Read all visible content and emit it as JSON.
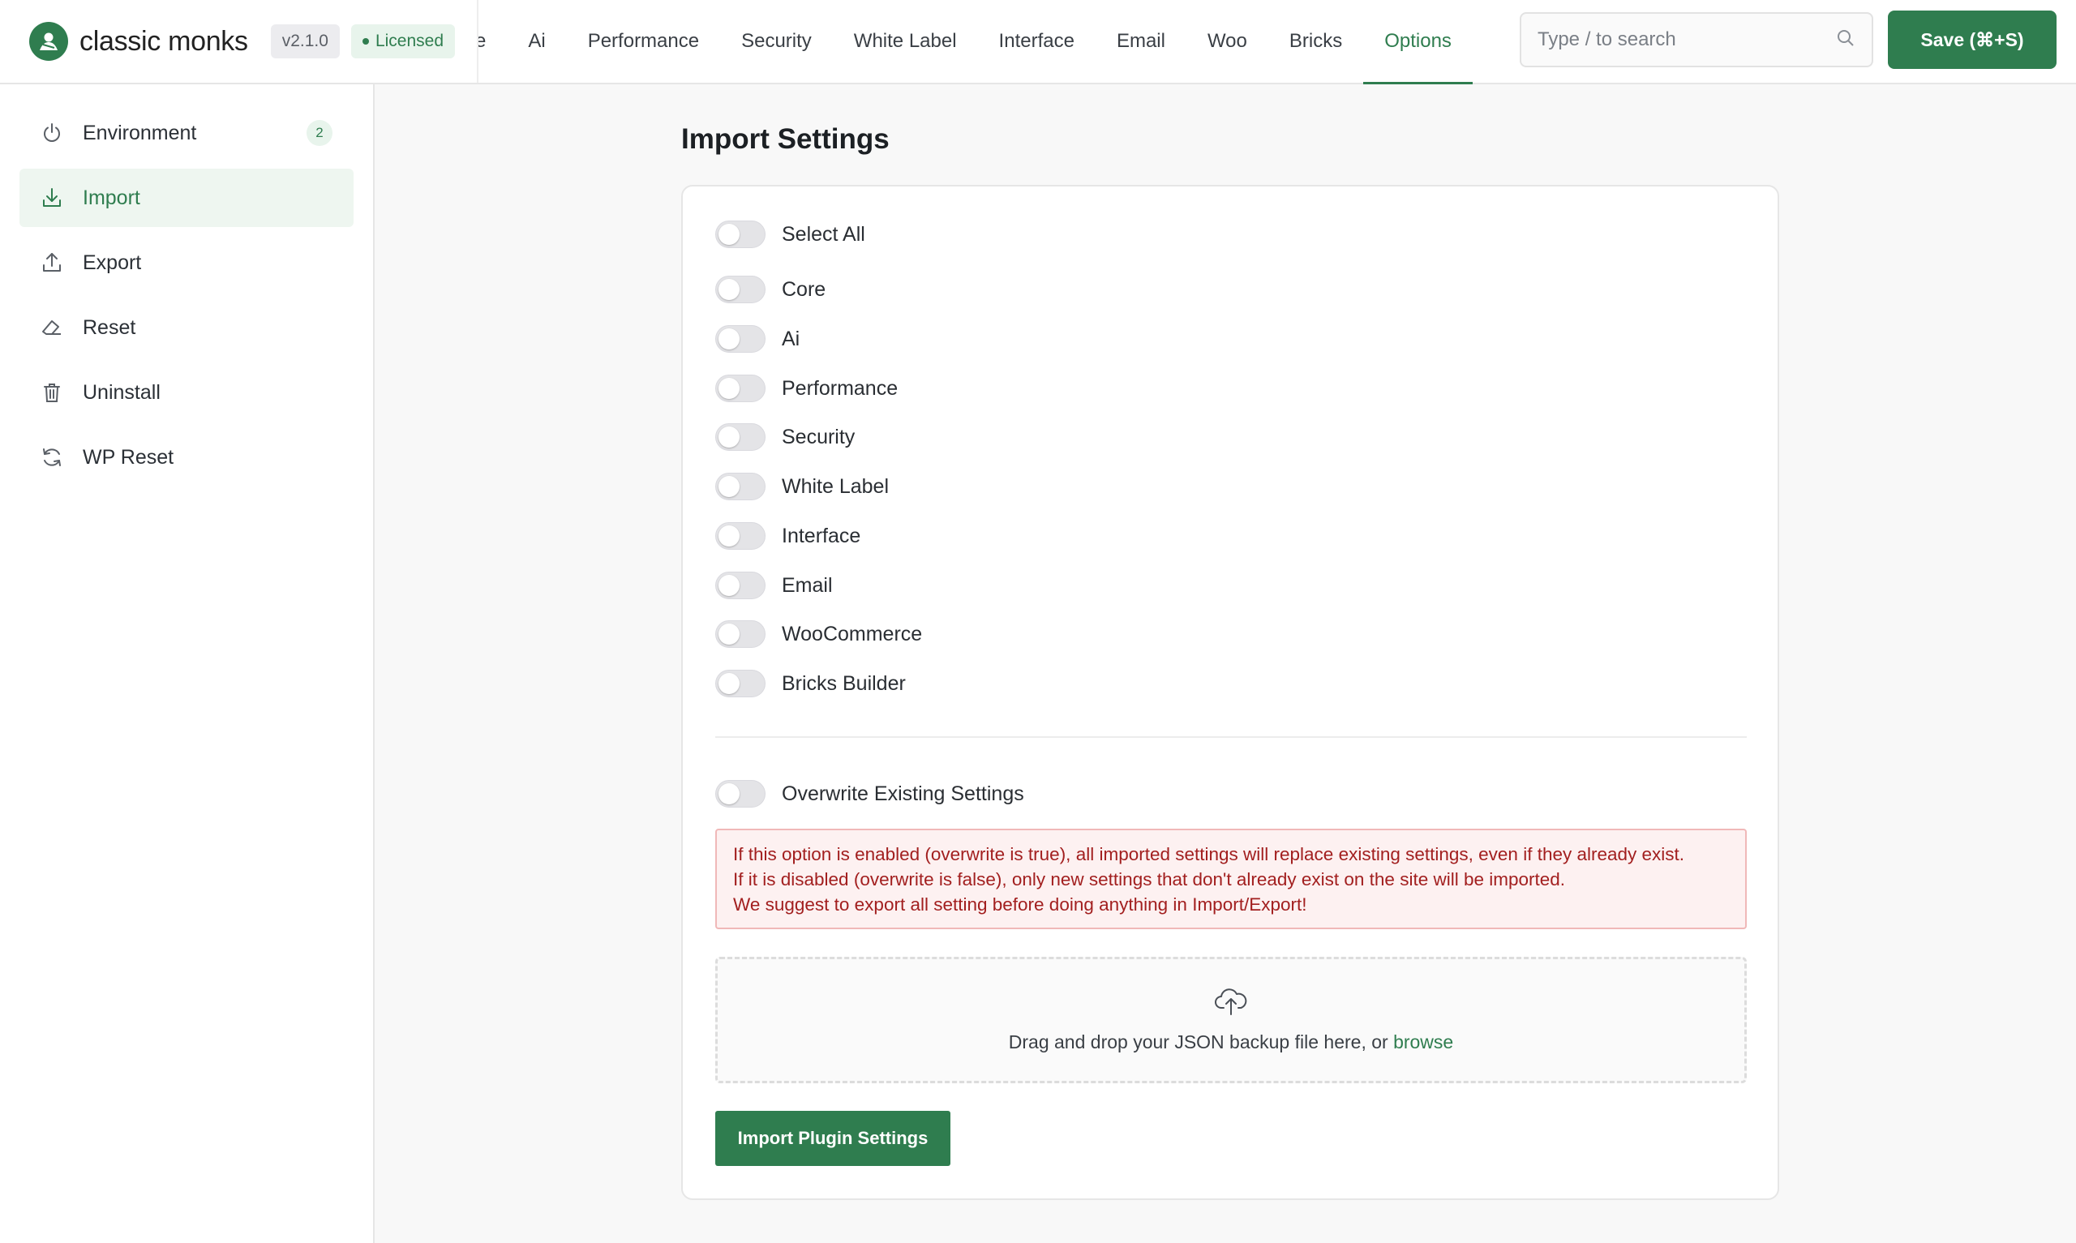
{
  "brand": {
    "name": "classic monks",
    "version": "v2.1.0",
    "license": "Licensed"
  },
  "nav": {
    "items": [
      {
        "label": "e",
        "active": false
      },
      {
        "label": "Ai",
        "active": false
      },
      {
        "label": "Performance",
        "active": false
      },
      {
        "label": "Security",
        "active": false
      },
      {
        "label": "White Label",
        "active": false
      },
      {
        "label": "Interface",
        "active": false
      },
      {
        "label": "Email",
        "active": false
      },
      {
        "label": "Woo",
        "active": false
      },
      {
        "label": "Bricks",
        "active": false
      },
      {
        "label": "Options",
        "active": true
      }
    ]
  },
  "search": {
    "placeholder": "Type / to search",
    "value": ""
  },
  "save_label": "Save (⌘+S)",
  "sidebar": {
    "items": [
      {
        "label": "Environment",
        "icon": "power-icon",
        "badge": "2",
        "active": false
      },
      {
        "label": "Import",
        "icon": "download-icon",
        "active": true
      },
      {
        "label": "Export",
        "icon": "upload-icon",
        "active": false
      },
      {
        "label": "Reset",
        "icon": "eraser-icon",
        "active": false
      },
      {
        "label": "Uninstall",
        "icon": "trash-icon",
        "active": false
      },
      {
        "label": "WP Reset",
        "icon": "refresh-icon",
        "active": false
      }
    ]
  },
  "main": {
    "title": "Import Settings",
    "select_all": {
      "label": "Select All",
      "checked": false
    },
    "modules": [
      {
        "label": "Core",
        "checked": false
      },
      {
        "label": "Ai",
        "checked": false
      },
      {
        "label": "Performance",
        "checked": false
      },
      {
        "label": "Security",
        "checked": false
      },
      {
        "label": "White Label",
        "checked": false
      },
      {
        "label": "Interface",
        "checked": false
      },
      {
        "label": "Email",
        "checked": false
      },
      {
        "label": "WooCommerce",
        "checked": false
      },
      {
        "label": "Bricks Builder",
        "checked": false
      }
    ],
    "overwrite": {
      "label": "Overwrite Existing Settings",
      "checked": false
    },
    "warning_lines": [
      "If this option is enabled (overwrite is true), all imported settings will replace existing settings, even if they already exist.",
      "If it is disabled (overwrite is false), only new settings that don't already exist on the site will be imported.",
      "We suggest to export all setting before doing anything in Import/Export!"
    ],
    "dropzone": {
      "text": "Drag and drop your JSON backup file here, or",
      "link": "browse"
    },
    "import_button": "Import Plugin Settings"
  },
  "colors": {
    "accent": "#2f7d4f",
    "warning_text": "#a21f1f",
    "warning_bg": "#fdf1f1"
  }
}
